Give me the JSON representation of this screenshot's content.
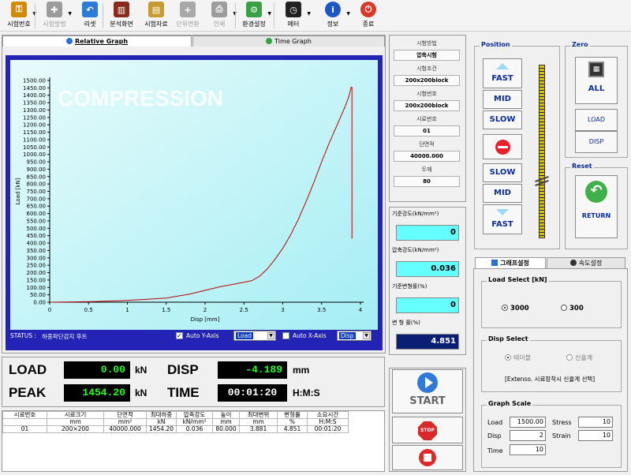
{
  "toolbar": {
    "items": [
      {
        "label": "시험번호",
        "icon": "key-icon",
        "color": "#d48a00",
        "disabled": false,
        "dropdown": true
      },
      {
        "label": "시험방법",
        "icon": "puzzle-icon",
        "color": "#9c9c9c",
        "disabled": true,
        "dropdown": true
      },
      {
        "label": "리셋",
        "icon": "undo-icon",
        "color": "#2a7cd6",
        "disabled": false,
        "dropdown": false
      },
      {
        "label": "분석화면",
        "icon": "bar-chart-icon",
        "color": "#8a2a1a",
        "disabled": false,
        "dropdown": false
      },
      {
        "label": "시험자료",
        "icon": "file-cabinet-icon",
        "color": "#c89b30",
        "disabled": false,
        "dropdown": false
      },
      {
        "label": "단위변환",
        "icon": "plus-icon",
        "color": "#a8a8a8",
        "disabled": true,
        "dropdown": false
      },
      {
        "label": "인쇄",
        "icon": "printer-icon",
        "color": "#9c9c9c",
        "disabled": true,
        "dropdown": true
      },
      {
        "label": "환경설정",
        "icon": "gear-icon",
        "color": "#3aa047",
        "disabled": false,
        "dropdown": true
      },
      {
        "label": "메터",
        "icon": "clock-icon",
        "color": "#222222",
        "disabled": false,
        "dropdown": true
      },
      {
        "label": "정보",
        "icon": "info-icon",
        "color": "#1b57c9",
        "disabled": false,
        "dropdown": true
      },
      {
        "label": "종료",
        "icon": "power-icon",
        "color": "#d83a2a",
        "disabled": false,
        "dropdown": false
      }
    ]
  },
  "graph_tabs": {
    "relative": "Relative Graph",
    "time": "Time Graph"
  },
  "chart_data": {
    "type": "line",
    "watermark": "COMPRESSION",
    "xlabel": "Disp [mm]",
    "ylabel": "Load [kN]",
    "xlim": [
      0,
      4
    ],
    "ylim": [
      0,
      1500
    ],
    "xticks": [
      "0",
      "0.5",
      "1",
      "1.5",
      "2",
      "2.5",
      "3",
      "3.5",
      "4"
    ],
    "yticks": [
      "0.00",
      "50.00",
      "100.00",
      "150.00",
      "200.00",
      "250.00",
      "300.00",
      "350.00",
      "400.00",
      "450.00",
      "500.00",
      "550.00",
      "600.00",
      "650.00",
      "700.00",
      "750.00",
      "800.00",
      "850.00",
      "900.00",
      "950.00",
      "1000.00",
      "1050.00",
      "1100.00",
      "1150.00",
      "1200.00",
      "1250.00",
      "1300.00",
      "1350.00",
      "1400.00",
      "1450.00",
      "1500.00"
    ],
    "grid": false,
    "series": [
      {
        "color": "#c00000",
        "x": [
          0,
          0.3,
          0.6,
          0.9,
          1.2,
          1.5,
          1.8,
          2.0,
          2.2,
          2.4,
          2.6,
          2.7,
          2.8,
          2.9,
          3.0,
          3.1,
          3.2,
          3.3,
          3.4,
          3.5,
          3.6,
          3.7,
          3.8,
          3.85,
          3.88,
          3.89,
          3.89,
          3.89
        ],
        "y": [
          0,
          2,
          5,
          10,
          18,
          28,
          55,
          80,
          105,
          125,
          145,
          175,
          225,
          290,
          365,
          455,
          560,
          680,
          810,
          950,
          1080,
          1200,
          1320,
          1390,
          1454,
          1454,
          1000,
          430
        ]
      }
    ]
  },
  "graph_status": {
    "status_label": "STATUS :",
    "status_text": "하중파단감지 후트",
    "auto_y": "Auto Y-Axis",
    "y_select": "Load",
    "auto_x": "Auto X-Axis",
    "x_select": "Disp"
  },
  "info": [
    {
      "label": "시험방법",
      "value": "압축시험"
    },
    {
      "label": "시험조건",
      "value": "200x200block"
    },
    {
      "label": "시험번호",
      "value": "200x200block"
    },
    {
      "label": "시료번호",
      "value": "01"
    },
    {
      "label": "단면적",
      "value": "40000.000"
    },
    {
      "label": "두께",
      "value": "80"
    }
  ],
  "strength": [
    {
      "label": "기준강도(kN/mm²)",
      "value": "0",
      "dark": false
    },
    {
      "label": "압축강도(kN/mm²)",
      "value": "0.036",
      "dark": false
    },
    {
      "label": "기준변형률(%)",
      "value": "0",
      "dark": false
    },
    {
      "label": "변 형 률(%)",
      "value": "4.851",
      "dark": true
    }
  ],
  "position": {
    "title": "Position",
    "fast_up": "FAST",
    "mid_up": "MID",
    "slow_up": "SLOW",
    "slow_down": "SLOW",
    "mid_down": "MID",
    "fast_down": "FAST"
  },
  "zero": {
    "title": "Zero",
    "all": "ALL",
    "load": "LOAD",
    "disp": "DISP"
  },
  "reset": {
    "title": "Reset",
    "return": "RETURN"
  },
  "settings_tabs": {
    "graph": "그래프설정",
    "speed": "속도설정"
  },
  "load_select": {
    "title": "Load Select [kN]",
    "opt1": "3000",
    "opt2": "300",
    "selected": "3000"
  },
  "disp_select": {
    "title": "Disp Select",
    "opt1": "테이블",
    "opt2": "신율계",
    "note": "[Extenso. 시료장착시 신율계 선택]"
  },
  "graph_scale": {
    "title": "Graph Scale",
    "load_label": "Load",
    "load_value": "1500.00",
    "stress_label": "Stress",
    "stress_value": "10",
    "disp_label": "Disp",
    "disp_value": "2",
    "strain_label": "Strain",
    "strain_value": "10",
    "time_label": "Time",
    "time_value": "10"
  },
  "readouts": {
    "load_label": "LOAD",
    "load_value": "0.00",
    "load_unit": "kN",
    "disp_label": "DISP",
    "disp_value": "-4.189",
    "disp_unit": "mm",
    "peak_label": "PEAK",
    "peak_value": "1454.20",
    "peak_unit": "kN",
    "time_label": "TIME",
    "time_value": "00:01:20",
    "time_unit": "H:M:S"
  },
  "controls": {
    "start": "START",
    "stop_label": "STOP"
  },
  "results": {
    "headers": [
      "시료번호",
      "시료크기",
      "단면적",
      "최대하중",
      "압축강도",
      "높이",
      "최대변위",
      "변형률",
      "소요시간"
    ],
    "units": [
      "",
      "mm",
      "mm²",
      "kN",
      "kN/mm²",
      "mm",
      "mm",
      "%",
      "H:M:S"
    ],
    "rows": [
      [
        "01",
        "200×200",
        "40000.000",
        "1454.20",
        "0.036",
        "80.000",
        "3.881",
        "4.851",
        "00:01:20"
      ]
    ]
  }
}
